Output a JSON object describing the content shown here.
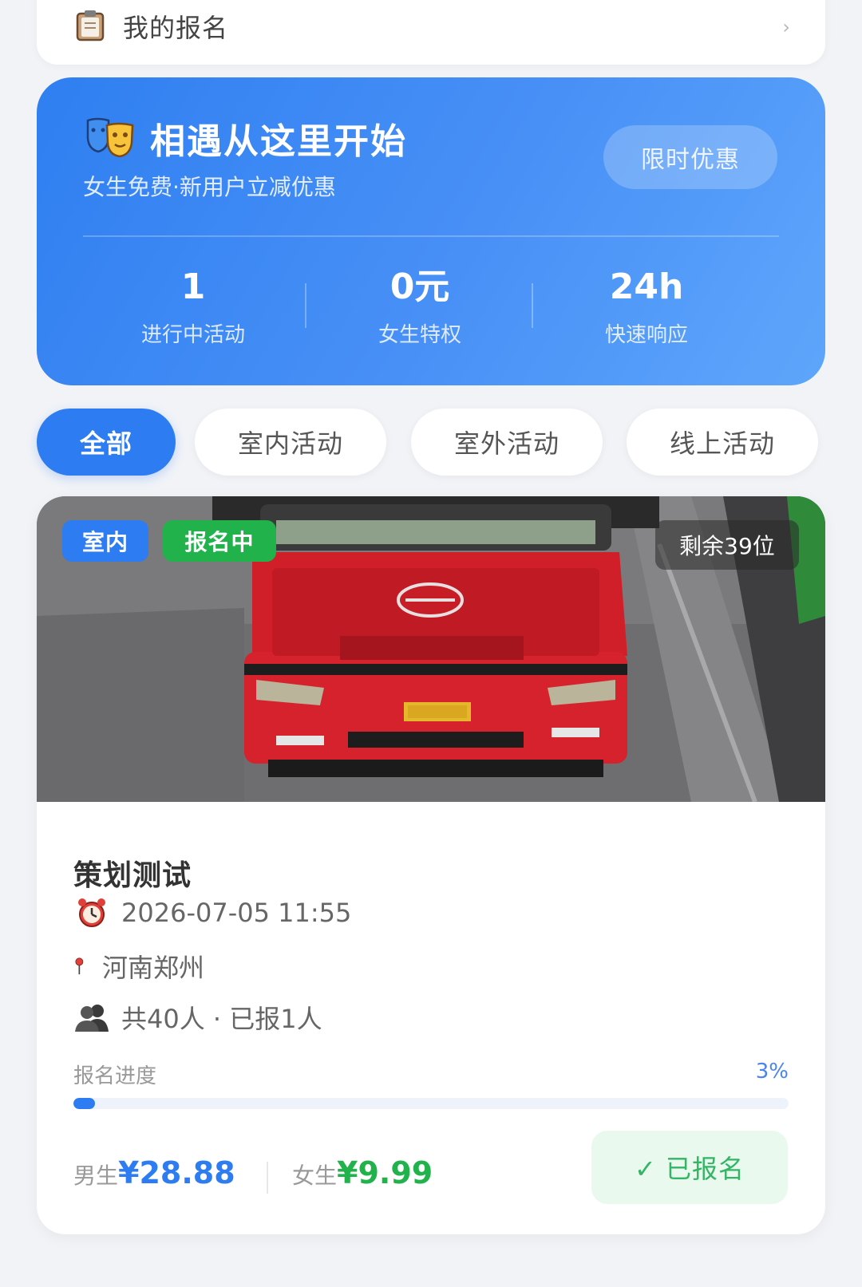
{
  "my_registrations": {
    "label": "我的报名",
    "icon": "clipboard-icon",
    "chevron": "›"
  },
  "hero": {
    "title": "相遇从这里开始",
    "subtitle": "女生免费·新用户立减优惠",
    "promo_button": "限时优惠",
    "icon": "masks-icon",
    "stats": [
      {
        "value": "1",
        "caption": "进行中活动"
      },
      {
        "value": "0元",
        "caption": "女生特权"
      },
      {
        "value": "24h",
        "caption": "快速响应"
      }
    ]
  },
  "tabs": [
    {
      "label": "全部",
      "active": true
    },
    {
      "label": "室内活动",
      "active": false
    },
    {
      "label": "室外活动",
      "active": false
    },
    {
      "label": "线上活动",
      "active": false
    }
  ],
  "activity": {
    "badge_type": "室内",
    "badge_status": "报名中",
    "remaining": "剩余39位",
    "name": "策划测试",
    "datetime": "2026-07-05 11:55",
    "location": "河南郑州",
    "attendance": "共40人 · 已报1人",
    "progress_label": "报名进度",
    "progress_text": "3%",
    "progress_fraction": 0.03,
    "male_label": "男生",
    "male_price": "¥28.88",
    "female_label": "女生",
    "female_price": "¥9.99",
    "action_button": "✓ 已报名"
  },
  "colors": {
    "accent_blue": "#2d7cf2",
    "badge_indoor": "#2d7cf2",
    "badge_status": "#22b24c",
    "female_price": "#22b24c",
    "signed_text": "#33b565",
    "background": "#f1f3f7"
  }
}
